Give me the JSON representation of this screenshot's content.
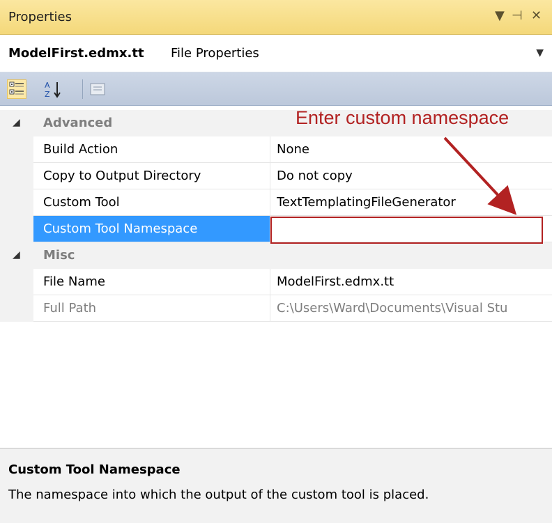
{
  "window": {
    "title": "Properties",
    "controls": {
      "dropdown": "▼",
      "pin": "⊣",
      "close": "✕"
    }
  },
  "object_selector": {
    "name": "ModelFirst.edmx.tt",
    "type": "File Properties"
  },
  "toolbar": {
    "buttons": [
      {
        "icon": "categorized-icon",
        "selected": true
      },
      {
        "icon": "alphabetical-icon",
        "selected": false
      },
      {
        "icon": "property-pages-icon",
        "selected": false
      }
    ]
  },
  "grid": {
    "categories": [
      {
        "name": "Advanced",
        "expanded": true,
        "properties": [
          {
            "name": "Build Action",
            "value": "None"
          },
          {
            "name": "Copy to Output Directory",
            "value": "Do not copy"
          },
          {
            "name": "Custom Tool",
            "value": "TextTemplatingFileGenerator"
          },
          {
            "name": "Custom Tool Namespace",
            "value": "",
            "selected": true
          }
        ]
      },
      {
        "name": "Misc",
        "expanded": true,
        "properties": [
          {
            "name": "File Name",
            "value": "ModelFirst.edmx.tt"
          },
          {
            "name": "Full Path",
            "value": "C:\\Users\\Ward\\Documents\\Visual Stu",
            "readonly": true
          }
        ]
      }
    ]
  },
  "annotation": {
    "text": "Enter custom namespace",
    "color": "#b22222"
  },
  "description": {
    "title": "Custom Tool Namespace",
    "text": "The namespace into which the output of the custom tool is placed."
  },
  "colors": {
    "title_bar": "#f4d87a",
    "toolbar": "#bcc8db",
    "selection": "#3399ff"
  }
}
